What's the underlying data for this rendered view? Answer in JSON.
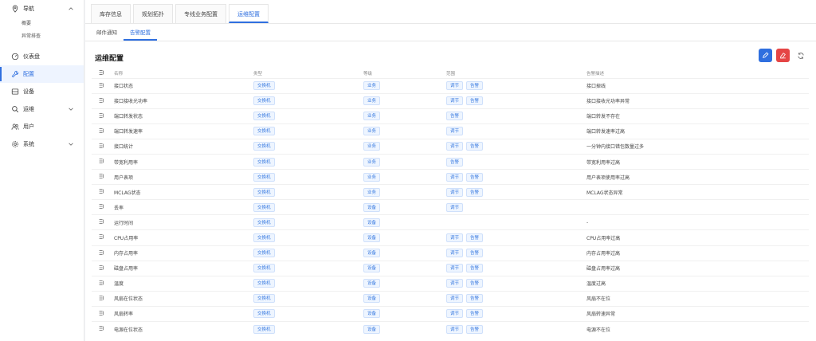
{
  "sidebar": {
    "groups": [
      {
        "label": "导航",
        "icon": "location-icon",
        "expanded": true,
        "children": [
          "概要",
          "异常排查"
        ]
      },
      {
        "label": "仪表盘",
        "icon": "dashboard-icon"
      },
      {
        "label": "配置",
        "icon": "wrench-icon",
        "active": true
      },
      {
        "label": "设备",
        "icon": "device-icon"
      },
      {
        "label": "运维",
        "icon": "search-icon",
        "expandable": true
      },
      {
        "label": "用户",
        "icon": "user-icon"
      },
      {
        "label": "系统",
        "icon": "settings-icon",
        "expandable": true
      }
    ]
  },
  "top_tabs": [
    "库存信息",
    "规划拓扑",
    "专线业务配置",
    "运维配置"
  ],
  "sub_tabs": [
    "邮件通知",
    "告警配置"
  ],
  "section": {
    "title": "运维配置"
  },
  "table": {
    "columns": [
      "名称",
      "类型",
      "等级",
      "范围",
      "告警描述"
    ],
    "rows": [
      {
        "name": "接口状态",
        "cat": "交换机",
        "type": "业务",
        "rules": [
          "调节",
          "告警"
        ],
        "desc": "接口掉线"
      },
      {
        "name": "接口接收光功率",
        "cat": "交换机",
        "type": "业务",
        "rules": [
          "调节",
          "告警"
        ],
        "desc": "接口接收光功率异常"
      },
      {
        "name": "端口转发状态",
        "cat": "交换机",
        "type": "业务",
        "rules": [
          "告警"
        ],
        "desc": "端口转发不存在"
      },
      {
        "name": "端口转发速率",
        "cat": "交换机",
        "type": "业务",
        "rules": [
          "调节"
        ],
        "desc": "端口转发速率过高"
      },
      {
        "name": "接口统计",
        "cat": "交换机",
        "type": "业务",
        "rules": [
          "调节",
          "告警"
        ],
        "desc": "一分钟内接口错包数量过多"
      },
      {
        "name": "带宽利用率",
        "cat": "交换机",
        "type": "业务",
        "rules": [
          "告警"
        ],
        "desc": "带宽利用率过高"
      },
      {
        "name": "用户表项",
        "cat": "交换机",
        "type": "业务",
        "rules": [
          "调节",
          "告警"
        ],
        "desc": "用户表项使用率过高"
      },
      {
        "name": "MCLAG状态",
        "cat": "交换机",
        "type": "业务",
        "rules": [
          "调节",
          "告警"
        ],
        "desc": "MCLAG状态异常"
      },
      {
        "name": "丢率",
        "cat": "交换机",
        "type": "设备",
        "rules": [
          "调节"
        ],
        "desc": ""
      },
      {
        "name": "运行时间",
        "cat": "交换机",
        "type": "设备",
        "rules": [],
        "desc": "-"
      },
      {
        "name": "CPU占用率",
        "cat": "交换机",
        "type": "设备",
        "rules": [
          "调节",
          "告警"
        ],
        "desc": "CPU占用率过高"
      },
      {
        "name": "内存占用率",
        "cat": "交换机",
        "type": "设备",
        "rules": [
          "调节",
          "告警"
        ],
        "desc": "内存占用率过高"
      },
      {
        "name": "磁盘占用率",
        "cat": "交换机",
        "type": "设备",
        "rules": [
          "调节",
          "告警"
        ],
        "desc": "磁盘占用率过高"
      },
      {
        "name": "温度",
        "cat": "交换机",
        "type": "设备",
        "rules": [
          "调节",
          "告警"
        ],
        "desc": "温度过高"
      },
      {
        "name": "风扇在位状态",
        "cat": "交换机",
        "type": "设备",
        "rules": [
          "调节",
          "告警"
        ],
        "desc": "风扇不在位"
      },
      {
        "name": "风扇转率",
        "cat": "交换机",
        "type": "设备",
        "rules": [
          "调节",
          "告警"
        ],
        "desc": "风扇转速异常"
      },
      {
        "name": "电源在位状态",
        "cat": "交换机",
        "type": "设备",
        "rules": [
          "调节",
          "告警"
        ],
        "desc": "电源不在位"
      }
    ]
  },
  "colors": {
    "accent": "#2f6fdf",
    "danger": "#e54545",
    "tag_blue": "#3a7be0",
    "tag_green": "#3a9a5a"
  }
}
